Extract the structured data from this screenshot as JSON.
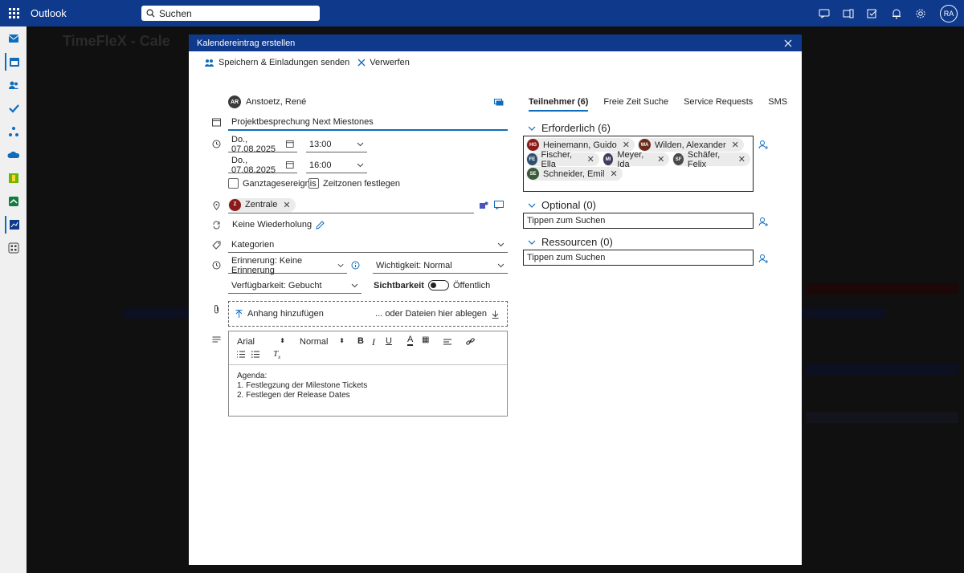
{
  "topbar": {
    "app_name": "Outlook",
    "search_placeholder": "Suchen",
    "avatar_initials": "RA"
  },
  "background": {
    "title": "TimeFleX - Cale"
  },
  "dialog": {
    "title": "Kalendereintrag erstellen",
    "save_label": "Speichern & Einladungen senden",
    "discard_label": "Verwerfen"
  },
  "organizer": {
    "initials": "AR",
    "name": "Anstoetz, René"
  },
  "event": {
    "title": "Projektbesprechung Next Miestones",
    "start_date": "Do., 07.08.2025",
    "start_time": "13:00",
    "end_date": "Do., 07.08.2025",
    "end_time": "16:00",
    "all_day_label": "Ganztagesereignis",
    "timezone_label": "Zeitzonen festlegen",
    "location_chip": {
      "initial": "Z",
      "label": "Zentrale",
      "color": "#8b1a1a"
    },
    "recurrence": "Keine Wiederholung",
    "categories": "Kategorien",
    "reminder": "Erinnerung: Keine Erinnerung",
    "importance": "Wichtigkeit: Normal",
    "availability": "Verfügbarkeit: Gebucht",
    "visibility_label": "Sichtbarkeit",
    "visibility_value": "Öffentlich",
    "attach_label": "Anhang hinzufügen",
    "drop_label": "... oder Dateien hier ablegen"
  },
  "editor": {
    "font": "Arial",
    "size": "Normal",
    "body_lines": [
      "Agenda:",
      "1. Festlegzung der Milestone Tickets",
      "2. Festlegen der Release Dates"
    ]
  },
  "tabs": [
    {
      "label": "Teilnehmer (6)",
      "active": true
    },
    {
      "label": "Freie Zeit Suche",
      "active": false
    },
    {
      "label": "Service Requests",
      "active": false
    },
    {
      "label": "SMS",
      "active": false
    }
  ],
  "required": {
    "heading": "Erforderlich (6)",
    "attendees": [
      {
        "initials": "HG",
        "name": "Heinemann, Guido",
        "color": "#8b1a1a"
      },
      {
        "initials": "WA",
        "name": "Wilden, Alexander",
        "color": "#6b2b1a"
      },
      {
        "initials": "FE",
        "name": "Fischer, Ella",
        "color": "#2f4f6f"
      },
      {
        "initials": "MI",
        "name": "Meyer, Ida",
        "color": "#3d3d5c"
      },
      {
        "initials": "SF",
        "name": "Schäfer, Felix",
        "color": "#4a4a4a"
      },
      {
        "initials": "SE",
        "name": "Schneider, Emil",
        "color": "#3a5a3a"
      }
    ]
  },
  "optional": {
    "heading": "Optional (0)",
    "placeholder": "Tippen zum Suchen"
  },
  "resources": {
    "heading": "Ressourcen (0)",
    "placeholder": "Tippen zum Suchen"
  }
}
